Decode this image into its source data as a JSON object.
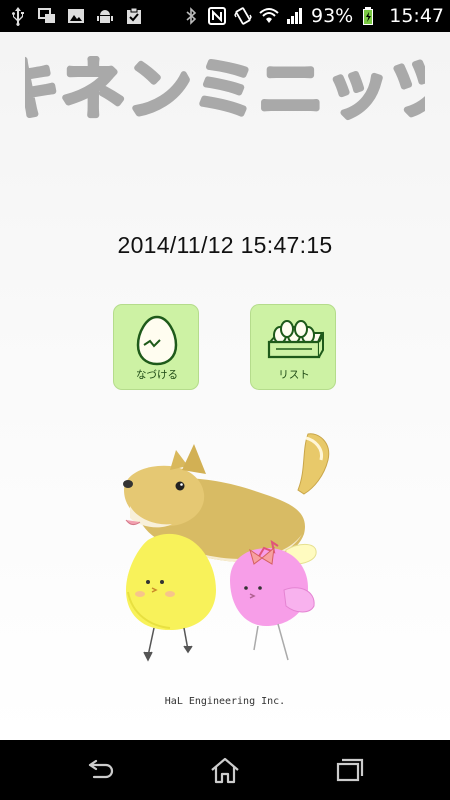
{
  "status_bar": {
    "battery_percent": "93%",
    "time": "15:47",
    "icons_left": [
      "usb-icon",
      "screen-mirror-icon",
      "image-icon",
      "android-icon",
      "clipboard-check-icon"
    ],
    "icons_right": [
      "bluetooth-icon",
      "nfc-icon",
      "vibrate-icon",
      "wifi-icon",
      "signal-icon",
      "battery-charging-icon"
    ]
  },
  "app": {
    "title": "キネンミニッツ",
    "datetime": "2014/11/12 15:47:15",
    "buttons": {
      "name": {
        "label": "なづける",
        "icon": "egg-icon"
      },
      "list": {
        "label": "リスト",
        "icon": "egg-box-icon"
      }
    },
    "footer": "HaL Engineering Inc.",
    "colors": {
      "button_bg": "#cdf2a4",
      "title_gray": "#a9a9a9",
      "icon_green": "#1e5a1a"
    }
  },
  "nav_bar": {
    "buttons": [
      "back-icon",
      "home-icon",
      "recent-apps-icon"
    ]
  }
}
